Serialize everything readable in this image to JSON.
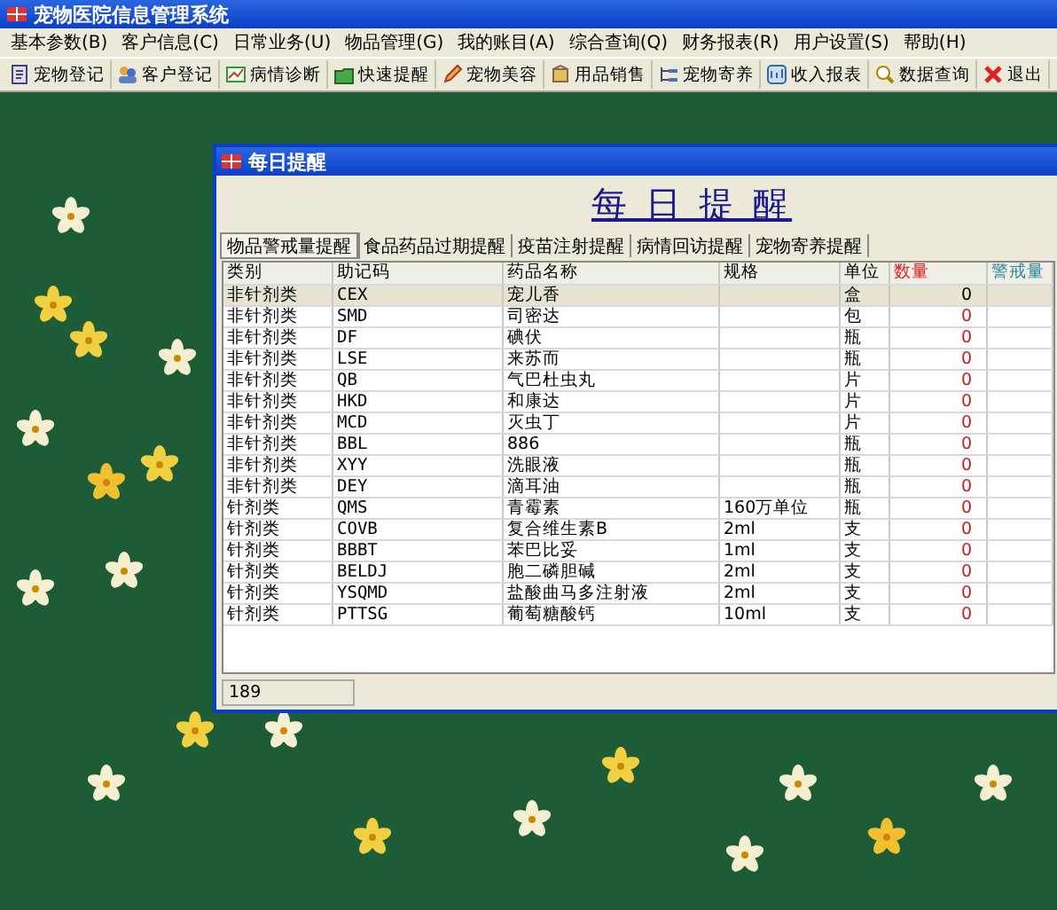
{
  "window": {
    "title": "宠物医院信息管理系统"
  },
  "menu": [
    "基本参数(B)",
    "客户信息(C)",
    "日常业务(U)",
    "物品管理(G)",
    "我的账目(A)",
    "综合查询(Q)",
    "财务报表(R)",
    "用户设置(S)",
    "帮助(H)"
  ],
  "toolbar": [
    "宠物登记",
    "客户登记",
    "病情诊断",
    "快速提醒",
    "宠物美容",
    "用品销售",
    "宠物寄养",
    "收入报表",
    "数据查询",
    "退出"
  ],
  "dialog": {
    "title": "每日提醒",
    "heading": "每 日 提 醒",
    "tabs": [
      {
        "label": "物品警戒量提醒",
        "selected": true
      },
      {
        "label": "食品药品过期提醒",
        "selected": false
      },
      {
        "label": "疫苗注射提醒",
        "selected": false
      },
      {
        "label": "病情回访提醒",
        "selected": false
      },
      {
        "label": "宠物寄养提醒",
        "selected": false
      }
    ],
    "columns": [
      {
        "label": "类别",
        "color": "#000000"
      },
      {
        "label": "助记码",
        "color": "#000000"
      },
      {
        "label": "药品名称",
        "color": "#000000"
      },
      {
        "label": "规格",
        "color": "#000000"
      },
      {
        "label": "单位",
        "color": "#000000"
      },
      {
        "label": "数量",
        "color": "#e02020"
      },
      {
        "label": "警戒量",
        "color": "#2a8a9a"
      }
    ],
    "rows": [
      {
        "category": "非针剂类",
        "code": "CEX",
        "name": "宠儿香",
        "spec": "",
        "unit": "盒",
        "quantity": "0",
        "selected": true
      },
      {
        "category": "非针剂类",
        "code": "SMD",
        "name": "司密达",
        "spec": "",
        "unit": "包",
        "quantity": "0",
        "selected": false
      },
      {
        "category": "非针剂类",
        "code": "DF",
        "name": "碘伏",
        "spec": "",
        "unit": "瓶",
        "quantity": "0",
        "selected": false
      },
      {
        "category": "非针剂类",
        "code": "LSE",
        "name": "来苏而",
        "spec": "",
        "unit": "瓶",
        "quantity": "0",
        "selected": false
      },
      {
        "category": "非针剂类",
        "code": "QB",
        "name": "气巴杜虫丸",
        "spec": "",
        "unit": "片",
        "quantity": "0",
        "selected": false
      },
      {
        "category": "非针剂类",
        "code": "HKD",
        "name": "和康达",
        "spec": "",
        "unit": "片",
        "quantity": "0",
        "selected": false
      },
      {
        "category": "非针剂类",
        "code": "MCD",
        "name": "灭虫丁",
        "spec": "",
        "unit": "片",
        "quantity": "0",
        "selected": false
      },
      {
        "category": "非针剂类",
        "code": "BBL",
        "name": "886",
        "spec": "",
        "unit": "瓶",
        "quantity": "0",
        "selected": false
      },
      {
        "category": "非针剂类",
        "code": "XYY",
        "name": "洗眼液",
        "spec": "",
        "unit": "瓶",
        "quantity": "0",
        "selected": false
      },
      {
        "category": "非针剂类",
        "code": "DEY",
        "name": "滴耳油",
        "spec": "",
        "unit": "瓶",
        "quantity": "0",
        "selected": false
      },
      {
        "category": "针剂类",
        "code": "QMS",
        "name": "青霉素",
        "spec": "160万单位",
        "unit": "瓶",
        "quantity": "0",
        "selected": false
      },
      {
        "category": "针剂类",
        "code": "COVB",
        "name": "复合维生素B",
        "spec": "2ml",
        "unit": "支",
        "quantity": "0",
        "selected": false
      },
      {
        "category": "针剂类",
        "code": "BBBT",
        "name": "苯巴比妥",
        "spec": "1ml",
        "unit": "支",
        "quantity": "0",
        "selected": false
      },
      {
        "category": "针剂类",
        "code": "BELDJ",
        "name": "胞二磷胆碱",
        "spec": "2ml",
        "unit": "支",
        "quantity": "0",
        "selected": false
      },
      {
        "category": "针剂类",
        "code": "YSQMD",
        "name": "盐酸曲马多注射液",
        "spec": "2ml",
        "unit": "支",
        "quantity": "0",
        "selected": false
      },
      {
        "category": "针剂类",
        "code": "PTTSG",
        "name": "葡萄糖酸钙",
        "spec": "10ml",
        "unit": "支",
        "quantity": "0",
        "selected": false
      }
    ],
    "status": "189"
  }
}
